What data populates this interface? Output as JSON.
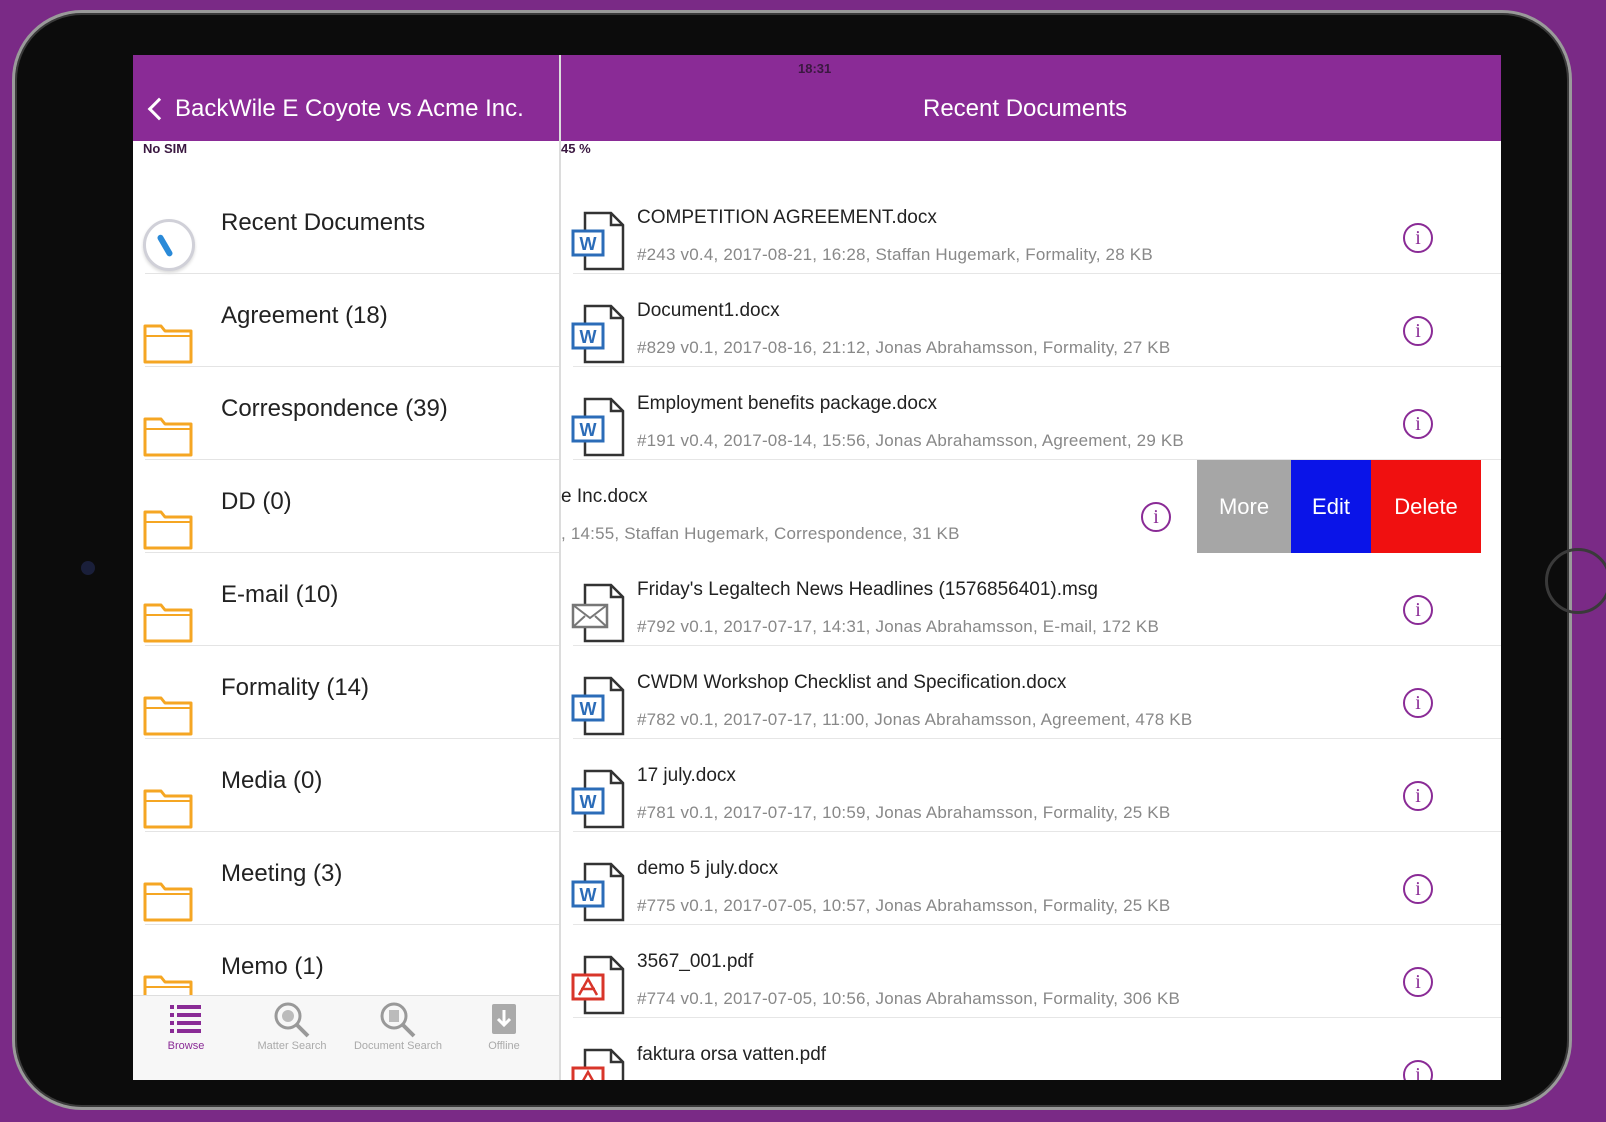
{
  "status_bar": {
    "carrier": "No SIM",
    "time": "18:31",
    "battery": "45 %"
  },
  "nav": {
    "back_label": "Back",
    "left_title": "Wile E Coyote vs Acme Inc.",
    "right_title": "Recent Documents"
  },
  "sidebar": {
    "items": [
      {
        "label": "Recent Documents",
        "icon": "clock-icon"
      },
      {
        "label": "Agreement (18)",
        "icon": "folder-icon"
      },
      {
        "label": "Correspondence (39)",
        "icon": "folder-icon"
      },
      {
        "label": "DD (0)",
        "icon": "folder-icon"
      },
      {
        "label": "E-mail (10)",
        "icon": "folder-icon"
      },
      {
        "label": "Formality (14)",
        "icon": "folder-icon"
      },
      {
        "label": "Media (0)",
        "icon": "folder-icon"
      },
      {
        "label": "Meeting (3)",
        "icon": "folder-icon"
      },
      {
        "label": "Memo (1)",
        "icon": "folder-icon"
      }
    ]
  },
  "tabs": [
    {
      "label": "Browse",
      "icon": "list-icon",
      "active": true
    },
    {
      "label": "Matter Search",
      "icon": "search-icon",
      "active": false
    },
    {
      "label": "Document Search",
      "icon": "document-search-icon",
      "active": false
    },
    {
      "label": "Offline",
      "icon": "download-icon",
      "active": false
    }
  ],
  "documents": [
    {
      "title": "COMPETITION AGREEMENT.docx",
      "meta": "#243 v0.4, 2017-08-21, 16:28,  Staffan Hugemark,  Formality,  28 KB",
      "type": "word"
    },
    {
      "title": "Document1.docx",
      "meta": "#829 v0.1, 2017-08-16, 21:12,  Jonas Abrahamsson,  Formality,  27 KB",
      "type": "word"
    },
    {
      "title": "Employment benefits package.docx",
      "meta": "#191 v0.4, 2017-08-14, 15:56,  Jonas Abrahamsson,  Agreement,  29 KB",
      "type": "word"
    },
    {
      "title": "e Inc.docx",
      "meta": ", 14:55,  Staffan Hugemark,  Correspondence,  31 KB",
      "type": "word"
    },
    {
      "title": "Friday's Legaltech News Headlines (1576856401).msg",
      "meta": "#792 v0.1, 2017-07-17, 14:31,  Jonas Abrahamsson,  E-mail,  172 KB",
      "type": "mail"
    },
    {
      "title": "CWDM Workshop Checklist and Specification.docx",
      "meta": "#782 v0.1, 2017-07-17, 11:00,  Jonas Abrahamsson,  Agreement,  478 KB",
      "type": "word"
    },
    {
      "title": "17 july.docx",
      "meta": "#781 v0.1, 2017-07-17, 10:59,  Jonas Abrahamsson,  Formality,  25 KB",
      "type": "word"
    },
    {
      "title": "demo 5 july.docx",
      "meta": "#775 v0.1, 2017-07-05, 10:57,  Jonas Abrahamsson,  Formality,  25 KB",
      "type": "word"
    },
    {
      "title": "3567_001.pdf",
      "meta": "#774 v0.1, 2017-07-05, 10:56,  Jonas Abrahamsson,  Formality,  306 KB",
      "type": "pdf"
    },
    {
      "title": "faktura orsa vatten.pdf",
      "meta": "",
      "type": "pdf"
    }
  ],
  "swipe_actions": {
    "more": "More",
    "edit": "Edit",
    "delete": "Delete"
  },
  "info_glyph": "i",
  "colors": {
    "accent": "#8a2b96",
    "edit": "#0a14e8",
    "delete": "#f01010",
    "more": "#a6a6a6",
    "folder": "#f5a623"
  }
}
